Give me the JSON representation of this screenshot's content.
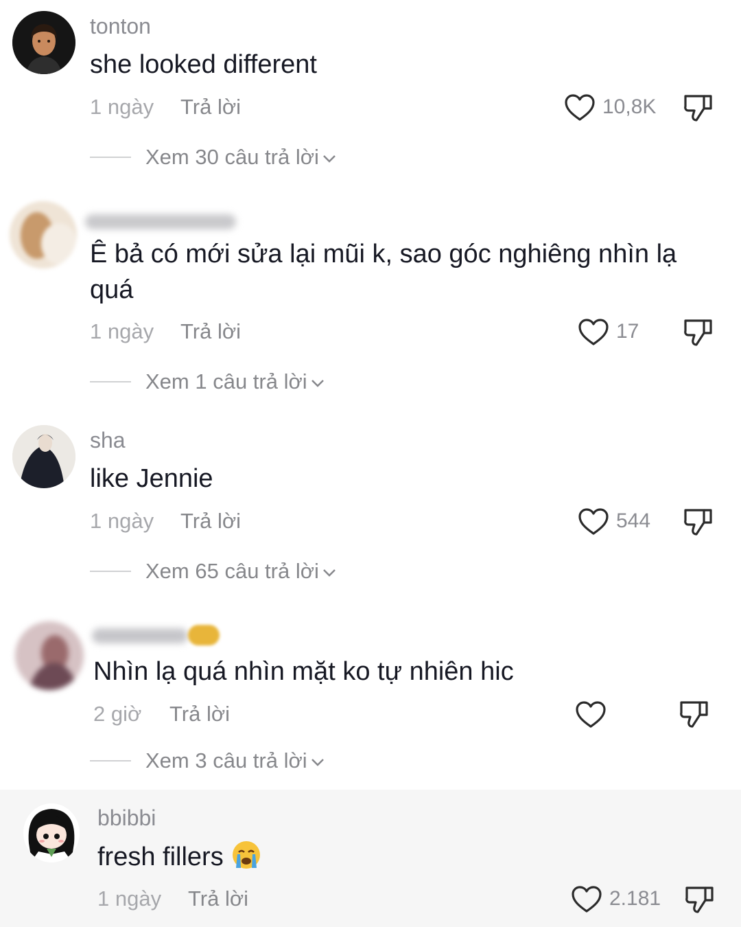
{
  "comments": [
    {
      "username": "tonton",
      "text": "she looked different",
      "time": "1 ngày",
      "reply_label": "Trả lời",
      "likes": "10,8K",
      "view_replies": "Xem 30 câu trả lời"
    },
    {
      "username": "",
      "text": "Ê bả có mới sửa lại mũi k, sao góc nghiêng nhìn lạ quá",
      "time": "1 ngày",
      "reply_label": "Trả lời",
      "likes": "17",
      "view_replies": "Xem 1 câu trả lời"
    },
    {
      "username": "sha",
      "text": "like Jennie",
      "time": "1 ngày",
      "reply_label": "Trả lời",
      "likes": "544",
      "view_replies": "Xem 65 câu trả lời"
    },
    {
      "username": "",
      "text": "Nhìn lạ quá nhìn mặt ko tự nhiên hic",
      "time": "2 giờ",
      "reply_label": "Trả lời",
      "likes": "",
      "view_replies": "Xem 3 câu trả lời"
    },
    {
      "username": "bbibbi",
      "text": "fresh fillers",
      "time": "1 ngày",
      "reply_label": "Trả lời",
      "likes": "2.181",
      "view_replies": ""
    }
  ],
  "icons": {
    "like": "heart-outline-icon",
    "dislike": "thumbs-down-outline-icon",
    "expand": "chevron-down-icon",
    "emoji": "loudly-crying-face-emoji"
  },
  "colors": {
    "text": "#161823",
    "muted": "#8a8b91",
    "icon": "#2b2b2b"
  }
}
